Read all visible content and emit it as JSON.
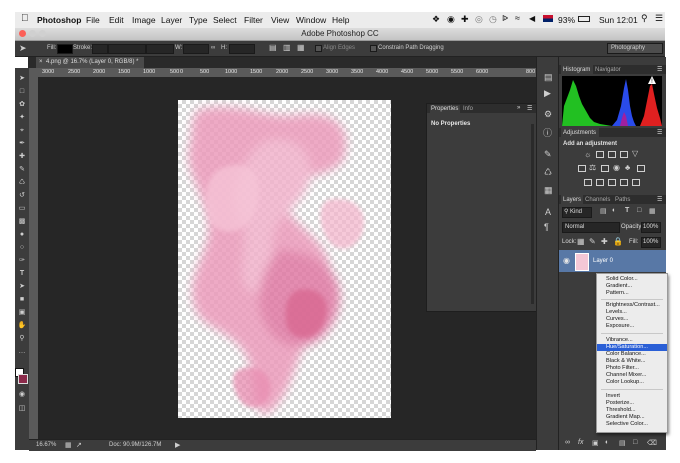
{
  "menubar": {
    "app_name": "Photoshop",
    "items": [
      "File",
      "Edit",
      "Image",
      "Layer",
      "Type",
      "Select",
      "Filter",
      "View",
      "Window",
      "Help"
    ],
    "battery": "93%",
    "clock": "Sun 12:01"
  },
  "window": {
    "title": "Adobe Photoshop CC"
  },
  "options": {
    "fill_label": "Fill:",
    "stroke_label": "Stroke:",
    "w_label": "W:",
    "h_label": "H:",
    "align_edges": "Align Edges",
    "constrain": "Constrain Path Dragging",
    "workspace": "Photography"
  },
  "document": {
    "tab_title": "4.png @ 16.7% (Layer 0, RGB/8) *",
    "zoom": "16.67%",
    "doc_size": "Doc: 90.9M/126.7M"
  },
  "ruler": {
    "labels": [
      "3000",
      "2500",
      "2000",
      "1500",
      "1000",
      "500",
      "0",
      "500",
      "1000",
      "1500",
      "2000",
      "2500",
      "3000",
      "3500",
      "4000",
      "4500",
      "5000",
      "5500",
      "6000",
      "6500",
      "7000",
      "7500",
      "800"
    ]
  },
  "panels": {
    "histogram_tab": "Histogram",
    "navigator_tab": "Navigator",
    "adjustments_tab": "Adjustments",
    "add_adjustment": "Add an adjustment",
    "layers_tab": "Layers",
    "channels_tab": "Channels",
    "paths_tab": "Paths",
    "kind_filter": "Kind",
    "blend_mode": "Normal",
    "opacity_label": "Opacity:",
    "opacity_value": "100%",
    "lock_label": "Lock:",
    "fill_label": "Fill:",
    "fill_value": "100%",
    "layer_name": "Layer 0"
  },
  "properties": {
    "tab_properties": "Properties",
    "tab_info": "Info",
    "message": "No Properties"
  },
  "adjustment_menu": {
    "groups": [
      [
        "Solid Color...",
        "Gradient...",
        "Pattern..."
      ],
      [
        "Brightness/Contrast...",
        "Levels...",
        "Curves...",
        "Exposure..."
      ],
      [
        "Vibrance...",
        "Hue/Saturation...",
        "Color Balance...",
        "Black & White...",
        "Photo Filter...",
        "Channel Mixer...",
        "Color Lookup..."
      ],
      [
        "Invert",
        "Posterize...",
        "Threshold...",
        "Gradient Map...",
        "Selective Color..."
      ]
    ],
    "highlighted": "Hue/Saturation..."
  },
  "colors": {
    "accent_highlight": "#2a5fd6",
    "panel_bg": "#3c3c3c",
    "workspace_bg": "#262626",
    "paint_pink": "#e89ab8",
    "histogram_red": "#e02020",
    "histogram_green": "#22c022",
    "histogram_blue": "#2a4bea"
  },
  "icons": [
    "apple-icon",
    "move-tool-icon",
    "lock-icon",
    "visibility-eye-icon",
    "wifi-icon",
    "volume-icon",
    "menu-list-icon",
    "search-icon"
  ]
}
